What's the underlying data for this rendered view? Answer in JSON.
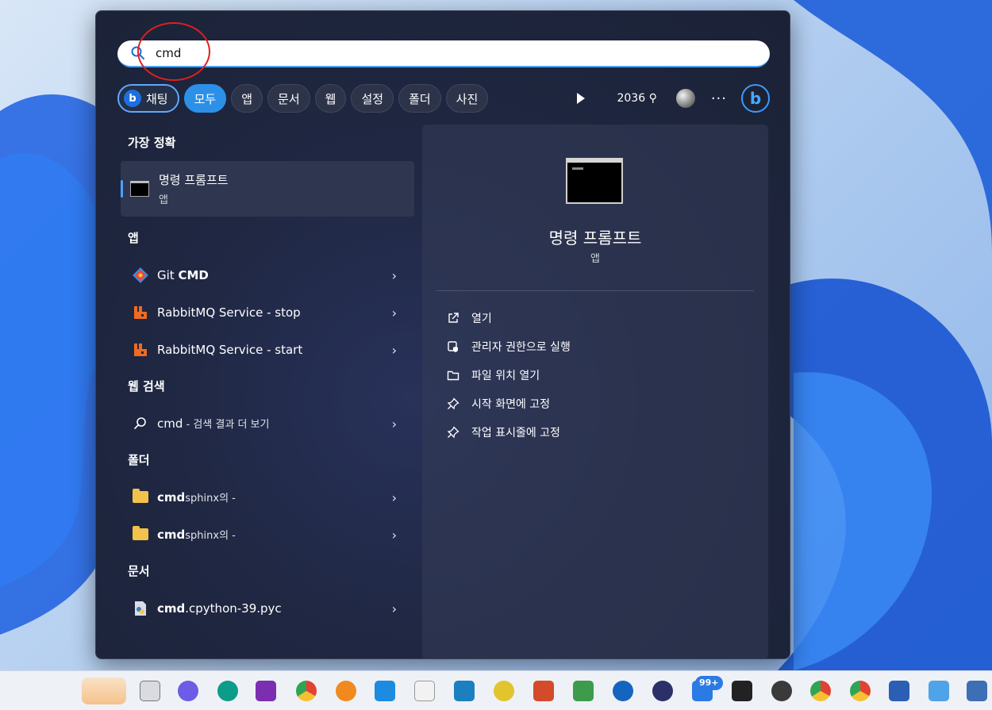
{
  "search": {
    "value": "cmd",
    "placeholder": ""
  },
  "filters": {
    "chat_label": "채팅",
    "items": [
      "모두",
      "앱",
      "문서",
      "웹",
      "설정",
      "폴더",
      "사진"
    ],
    "points": "2036 ⚲",
    "more": "···"
  },
  "sections": {
    "best_match": "가장 정확",
    "apps": "앱",
    "web": "웹 검색",
    "folders": "폴더",
    "documents": "문서"
  },
  "best_match": {
    "title": "명령 프롬프트",
    "subtitle": "앱"
  },
  "apps": [
    {
      "prefix": "Git ",
      "bold": "CMD",
      "suffix": ""
    },
    {
      "prefix": "RabbitMQ Service - stop",
      "bold": "",
      "suffix": ""
    },
    {
      "prefix": "RabbitMQ Service - start",
      "bold": "",
      "suffix": ""
    }
  ],
  "web_result": {
    "main": "cmd",
    "suffix": " - 검색 결과 더 보기"
  },
  "folders": [
    {
      "bold": "cmd",
      "rest": "sphinx의 -"
    },
    {
      "bold": "cmd",
      "rest": "sphinx의 -"
    }
  ],
  "documents": [
    {
      "bold": "cmd",
      "rest": ".cpython-39.pyc"
    }
  ],
  "detail": {
    "title": "명령 프롬프트",
    "subtitle": "앱",
    "actions": [
      "열기",
      "관리자 권한으로 실행",
      "파일 위치 열기",
      "시작 화면에 고정",
      "작업 표시줄에 고정"
    ]
  },
  "taskbar": {
    "badge": "99+"
  },
  "colors": {
    "accent": "#2d90e8",
    "panel": "#1f2742",
    "annotation": "#e0201c",
    "folder": "#f2c24b",
    "rabbitmq": "#f06a21"
  }
}
